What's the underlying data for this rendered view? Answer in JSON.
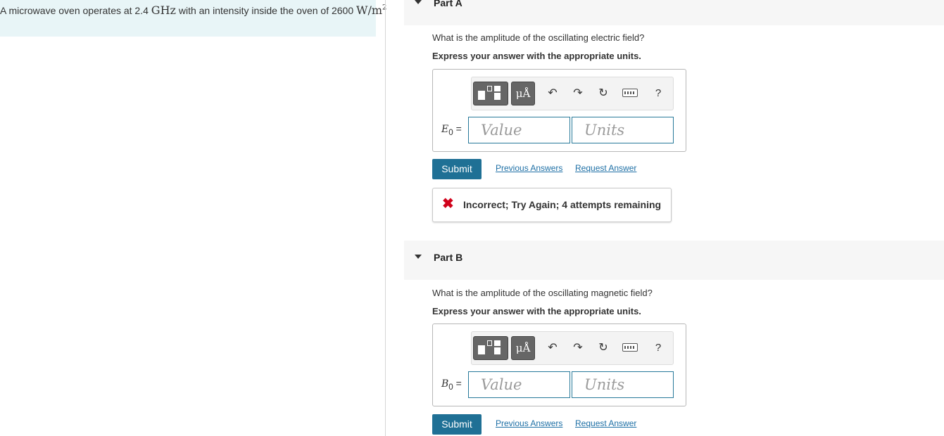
{
  "problem": {
    "text_before": "A microwave oven operates at 2.4 ",
    "freq_unit": "GHz",
    "text_after": " with an intensity inside the oven of 2600 ",
    "intensity_unit_base": "W/m",
    "intensity_unit_exp": "2"
  },
  "parts": [
    {
      "title": "Part A",
      "question": "What is the amplitude of the oscillating electric field?",
      "instruction": "Express your answer with the appropriate units.",
      "var_symbol": "E",
      "var_sub": "0",
      "var_eq": " =",
      "value_placeholder": "Value",
      "units_placeholder": "Units",
      "submit_label": "Submit",
      "previous_answers_label": "Previous Answers",
      "request_answer_label": "Request Answer",
      "feedback": "Incorrect; Try Again; 4 attempts remaining"
    },
    {
      "title": "Part B",
      "question": "What is the amplitude of the oscillating magnetic field?",
      "instruction": "Express your answer with the appropriate units.",
      "var_symbol": "B",
      "var_sub": "0",
      "var_eq": " =",
      "value_placeholder": "Value",
      "units_placeholder": "Units",
      "submit_label": "Submit",
      "previous_answers_label": "Previous Answers",
      "request_answer_label": "Request Answer"
    }
  ],
  "toolbar": {
    "units_label": "μÅ",
    "help_label": "?",
    "undo_icon": "↶",
    "redo_icon": "↷",
    "reset_icon": "↻"
  },
  "feedback_icon": "✖",
  "colors": {
    "problem_bg": "#e8f5f7",
    "submit_bg": "#1f7095",
    "link": "#1d6fa5",
    "error": "#d0021b",
    "field_border": "#27799a"
  }
}
